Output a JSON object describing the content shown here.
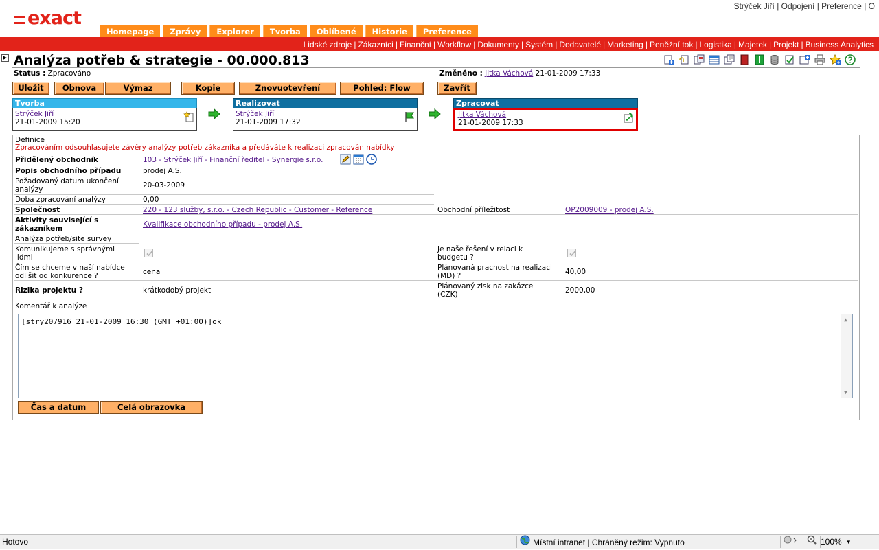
{
  "brand": {
    "logo_text": "exact"
  },
  "user_links": [
    {
      "label": "Strýček Jiří"
    },
    {
      "label": "Odpojení"
    },
    {
      "label": "Preference"
    },
    {
      "label": "O"
    }
  ],
  "main_tabs": [
    {
      "label": "Homepage"
    },
    {
      "label": "Zprávy"
    },
    {
      "label": "Explorer"
    },
    {
      "label": "Tvorba"
    },
    {
      "label": "Oblíbené"
    },
    {
      "label": "Historie"
    },
    {
      "label": "Preference"
    }
  ],
  "menu_bar": [
    "Lidské zdroje",
    "Zákazníci",
    "Finanční",
    "Workflow",
    "Dokumenty",
    "Systém",
    "Dodavatelé",
    "Marketing",
    "Peněžní tok",
    "Logistika",
    "Majetek",
    "Projekt",
    "Business Analytics"
  ],
  "page": {
    "title": "Analýza potřeb & strategie - 00.000.813",
    "status_label": "Status :",
    "status_value": "Zpracováno",
    "changed_label": "Změněno :",
    "changed_user": "Jitka Váchová",
    "changed_date": "21-01-2009 17:33"
  },
  "actions": {
    "save": "Uložit",
    "refresh": "Obnova",
    "delete": "Výmaz",
    "copy": "Kopie",
    "reopen": "Znovuotevření",
    "flow_view": "Pohled: Flow",
    "close": "Zavřít"
  },
  "workflow": [
    {
      "header": "Tvorba",
      "user": "Strýček Jiří",
      "date": "21-01-2009 15:20"
    },
    {
      "header": "Realizovat",
      "user": "Strýček Jiří",
      "date": "21-01-2009 17:32"
    },
    {
      "header": "Zpracovat",
      "user": "Jitka Váchová",
      "date": "21-01-2009 17:33"
    }
  ],
  "form": {
    "definice_label": "Definice",
    "definice_text": "Zpracováním odsouhlasujete závěry analýzy potřeb zákazníka a předáváte k realizaci zpracován nabídky",
    "assigned_label": "Přidělený obchodník",
    "assigned_value": "103 - Strýček Jiří - Finanční ředitel - Synergie s.r.o.",
    "case_desc_label": "Popis obchodního případu",
    "case_desc_value": "prodej A.S.",
    "due_label_1": "Požadovaný datum ukončení",
    "due_label_2": "analýzy",
    "due_value": "20-03-2009",
    "duration_label": "Doba zpracování analýzy",
    "duration_value": "0,00",
    "company_label": "Společnost",
    "company_value": "220 - 123 služby, s.r.o. - Czech Republic - Customer - Reference",
    "opportunity_label": "Obchodní příležitost",
    "opportunity_value": "OP2009009 - prodej A.S.",
    "activities_label_1": "Aktivity související s",
    "activities_label_2": "zákazníkem",
    "activities_value": "Kvalifikace obchodního případu - prodej A.S.",
    "survey_label": "Analýza potřeb/site survey",
    "communicate_label_1": "Komunikujeme s správnými",
    "communicate_label_2": "lidmi",
    "budget_label_1": "Je naše řešení v relaci k",
    "budget_label_2": "budgetu ?",
    "differ_label_1": "Čím se chceme v naší nabídce",
    "differ_label_2": "odlišit od konkurence ?",
    "differ_value": "cena",
    "effort_label_1": "Plánovaná pracnost na realizaci",
    "effort_label_2": "(MD) ?",
    "effort_value": "40,00",
    "risk_label": "Rizika projektu ?",
    "risk_value": "krátkodobý projekt",
    "profit_label_1": "Plánovaný zisk na zakázce",
    "profit_label_2": "(CZK)",
    "profit_value": "2000,00",
    "comment_label": "Komentář k analýze",
    "comment_value": "[stry207916 21-01-2009 16:30 (GMT +01:00)]ok",
    "btn_datetime": "Čas a datum",
    "btn_fullscreen": "Celá obrazovka"
  },
  "statusbar": {
    "left": "Hotovo",
    "zone": "Místní intranet | Chráněný režim: Vypnuto",
    "zoom": "100%"
  },
  "colors": {
    "brand_red": "#e2231a",
    "tab_orange": "#ff8c1a",
    "button_orange": "#ffb066",
    "step_header": "#0f6fa0",
    "step_header_first": "#35b6ea",
    "highlight_border": "#e00000"
  }
}
